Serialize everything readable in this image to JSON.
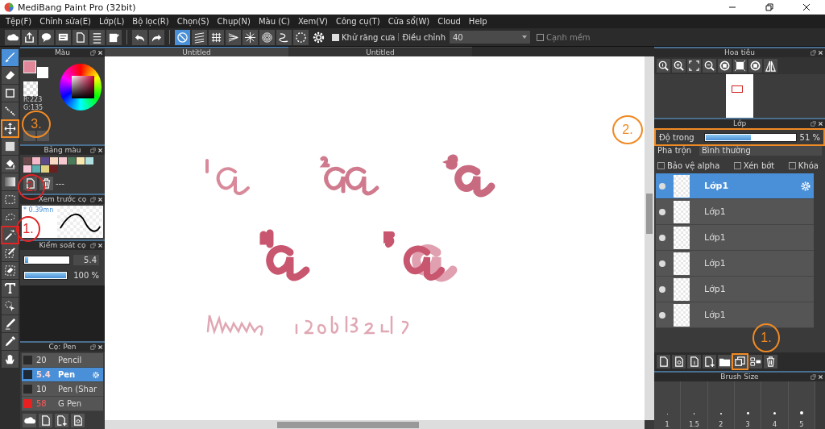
{
  "window": {
    "title": "MediBang Paint Pro (32bit)"
  },
  "menu": [
    "Tệp(F)",
    "Chỉnh sửa(E)",
    "Lớp(L)",
    "Bộ lọc(R)",
    "Chọn(S)",
    "Chụp(N)",
    "Màu (C)",
    "Xem(V)",
    "Công cụ(T)",
    "Cửa sổ(W)",
    "Cloud",
    "Help"
  ],
  "toolbar": {
    "snap_buttons": [
      {
        "selected": true
      },
      {
        "selected": false
      },
      {
        "selected": false
      },
      {
        "selected": false
      },
      {
        "selected": false
      },
      {
        "selected": false
      },
      {
        "selected": false
      },
      {
        "selected": false
      }
    ],
    "antialias": {
      "label": "Khử răng cưa",
      "checked": true
    },
    "correction": {
      "label": "Điều chỉnh",
      "value": "40"
    },
    "soft_edge": {
      "label": "Cạnh mềm",
      "checked": false
    }
  },
  "tools": [
    {
      "selected": true
    },
    {
      "selected": false
    },
    {
      "selected": false
    },
    {
      "selected": false
    },
    {
      "selected": false,
      "color": "#f08a24"
    },
    {
      "selected": false
    },
    {
      "selected": false
    },
    {
      "selected": false
    },
    {
      "selected": false
    },
    {
      "selected": false
    },
    {
      "selected": false,
      "color": "#e02424"
    },
    {
      "selected": false
    },
    {
      "selected": false
    },
    {
      "selected": false
    },
    {
      "selected": false
    },
    {
      "selected": false
    },
    {
      "selected": false
    },
    {
      "selected": false
    }
  ],
  "color_panel": {
    "title": "Màu",
    "primary": {
      "color": "#e0879a"
    },
    "readings": [
      "R:223",
      "G:135"
    ]
  },
  "palette": {
    "title": "Bảng màu",
    "swatches": [
      {
        "color": "#6a4a4a"
      },
      {
        "color": "#f4b8c8"
      },
      {
        "color": "#5a4a8a"
      },
      {
        "color": "#f8d8c0"
      },
      {
        "color": "#f8c8d0"
      },
      {
        "color": "#4a7a5a"
      },
      {
        "color": "#f8e8b0"
      },
      {
        "color": "#b0e0e0"
      },
      {
        "color": "#f8c8d8"
      },
      {
        "color": "#5ab0b0"
      },
      {
        "color": "#e0d080"
      },
      {
        "color": "#6a2020"
      }
    ],
    "name": "---"
  },
  "brush_preview": {
    "title": "Xem trước cọ",
    "size": "* 0.39mn"
  },
  "brush_control": {
    "title": "Kiểm soát cọ",
    "sliders": [
      {
        "level": 0.08,
        "reading": "5.4"
      },
      {
        "level": 1,
        "reading": "100 %"
      }
    ]
  },
  "brushes": {
    "title": "Cọ: Pen",
    "items": [
      {
        "size": "20",
        "name": "Pencil",
        "color": "#2a2a2a",
        "selected": false,
        "size_alert": false
      },
      {
        "size": "5.4",
        "name": "Pen",
        "color": "#1e2a38",
        "selected": true,
        "size_alert": true
      },
      {
        "size": "10",
        "name": "Pen (Shar",
        "color": "#2a2a2a",
        "selected": false,
        "size_alert": false
      },
      {
        "size": "58",
        "name": "G Pen",
        "color": "#e82020",
        "selected": false,
        "size_alert": true
      }
    ]
  },
  "canvas": {
    "tabs": [
      {
        "label": "Untitled",
        "selected": true
      },
      {
        "label": "Untitled",
        "selected": false
      }
    ]
  },
  "navigator": {
    "title": "Hoa tiêu"
  },
  "layers": {
    "title": "Lớp",
    "opacity": {
      "label": "Độ trong",
      "level": 0.51,
      "reading": "51 %",
      "highlighted": true
    },
    "blend": {
      "label": "Pha trộn",
      "value": "Bình thường"
    },
    "options": [
      {
        "label": "Bảo vệ alpha",
        "checked": false
      },
      {
        "label": "Xén bớt",
        "checked": false
      },
      {
        "label": "Khóa",
        "checked": false
      }
    ],
    "items": [
      {
        "name": "Lớp1",
        "selected": true
      },
      {
        "name": "Lớp1",
        "selected": false
      },
      {
        "name": "Lớp1",
        "selected": false
      },
      {
        "name": "Lớp1",
        "selected": false
      },
      {
        "name": "Lớp1",
        "selected": false
      },
      {
        "name": "Lớp1",
        "selected": false
      }
    ],
    "buttons": [
      {
        "highlighted": false
      },
      {
        "highlighted": false
      },
      {
        "highlighted": false
      },
      {
        "highlighted": false
      },
      {
        "highlighted": false
      },
      {
        "highlighted": true
      },
      {
        "highlighted": false
      },
      {
        "highlighted": false
      }
    ]
  },
  "brush_size": {
    "title": "Brush Size",
    "sizes": [
      "1",
      "1.5",
      "2",
      "3",
      "4",
      "5"
    ]
  },
  "callouts": [
    {
      "label": "3.",
      "color": "#f08a24"
    },
    {
      "label": "2.",
      "color": "#e02424"
    },
    {
      "label": "1.",
      "color": "#e02424"
    },
    {
      "label": "2.",
      "color": "#f08a24"
    },
    {
      "label": "1.",
      "color": "#f08a24"
    }
  ]
}
